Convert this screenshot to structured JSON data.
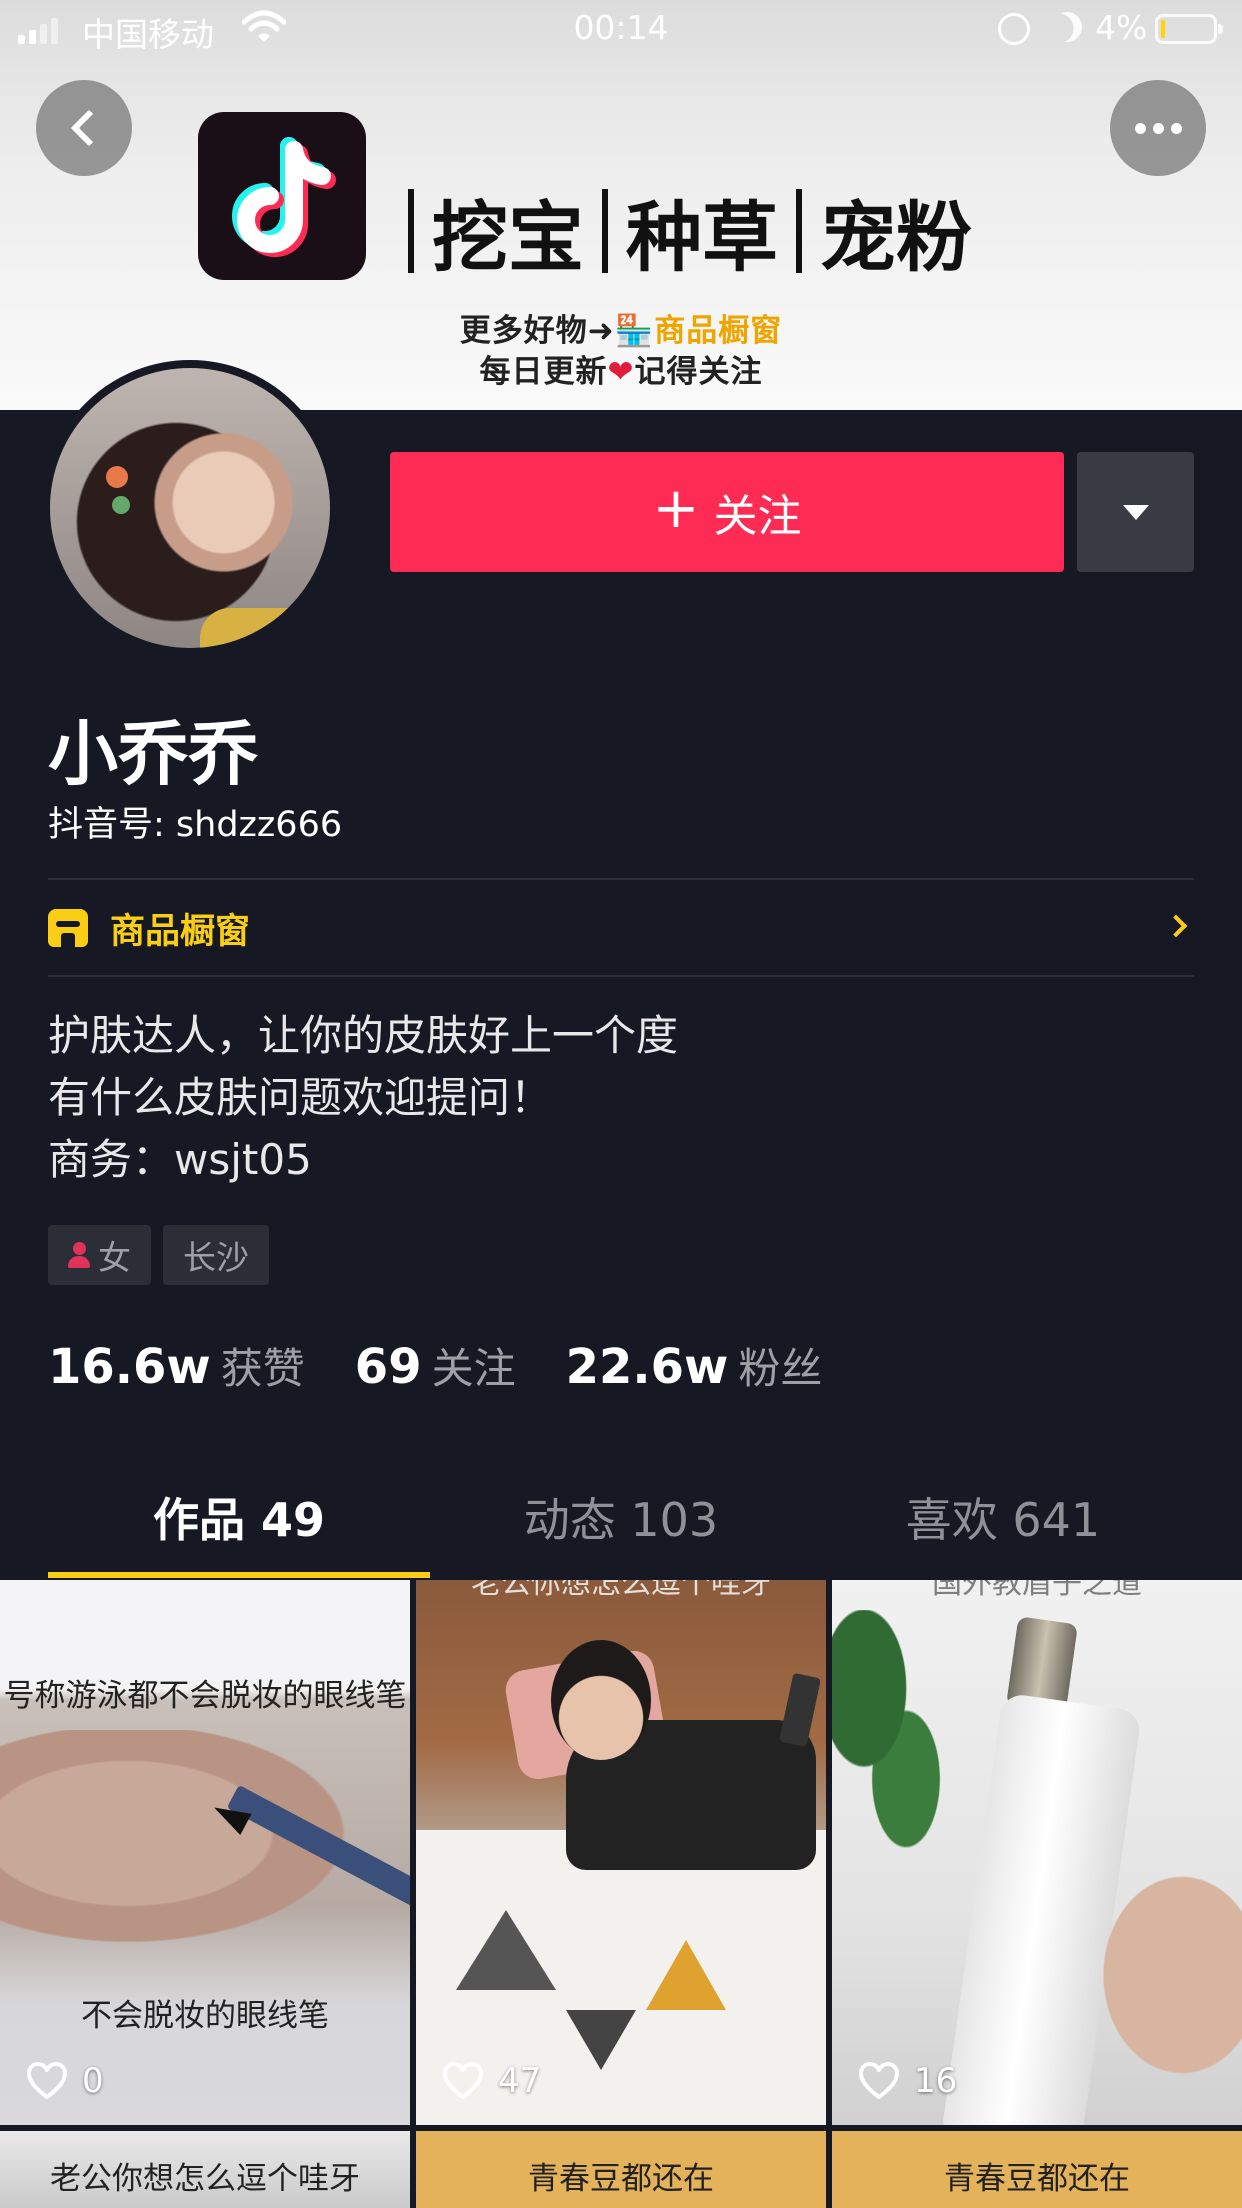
{
  "status_bar": {
    "carrier": "中国移动",
    "time": "00:14",
    "battery": "4%",
    "battery_level_fraction": 0.04
  },
  "banner": {
    "title_parts": [
      "挖宝",
      "种草",
      "宠粉"
    ],
    "subtitle_line1_a": "更多好物➜",
    "subtitle_line1_shop": "🏪商品橱窗",
    "subtitle_line2_a": "每日更新",
    "subtitle_line2_heart": "❤",
    "subtitle_line2_b": "记得关注"
  },
  "profile": {
    "follow_label": "关注",
    "follow_plus": "+",
    "nickname": "小乔乔",
    "douyin_id": "抖音号: shdzz666",
    "shop_window_label": "商品橱窗",
    "bio": [
      "护肤达人，让你的皮肤好上一个度",
      "有什么皮肤问题欢迎提问！",
      "商务：wsjt05"
    ],
    "tags": [
      "女",
      "长沙"
    ],
    "stats": [
      {
        "num": "16.6w",
        "label": "获赞"
      },
      {
        "num": "69",
        "label": "关注"
      },
      {
        "num": "22.6w",
        "label": "粉丝"
      }
    ]
  },
  "tabs": [
    {
      "label": "作品 49",
      "active": true
    },
    {
      "label": "动态 103",
      "active": false
    },
    {
      "label": "喜欢 641",
      "active": false
    }
  ],
  "videos": [
    {
      "caption_top": "号称游泳都不会脱妆的眼线笔",
      "caption_bottom": "不会脱妆的眼线笔",
      "likes": "0"
    },
    {
      "caption_top": "老公你想怎么逗个哇牙",
      "likes": "47"
    },
    {
      "caption_top": "国外教眉子之道",
      "likes": "16"
    }
  ],
  "videos_row2": [
    {
      "caption": "老公你想怎么逗个哇牙"
    },
    {
      "caption": "青春豆都还在"
    },
    {
      "caption": "青春豆都还在"
    }
  ],
  "icons": {
    "back": "chevron-left-icon",
    "more": "ellipsis-icon",
    "dropdown": "caret-down-icon",
    "shop": "shop-icon",
    "like": "heart-outline-icon"
  },
  "colors": {
    "background": "#161823",
    "follow": "#fe2c55",
    "accent": "#face15"
  }
}
